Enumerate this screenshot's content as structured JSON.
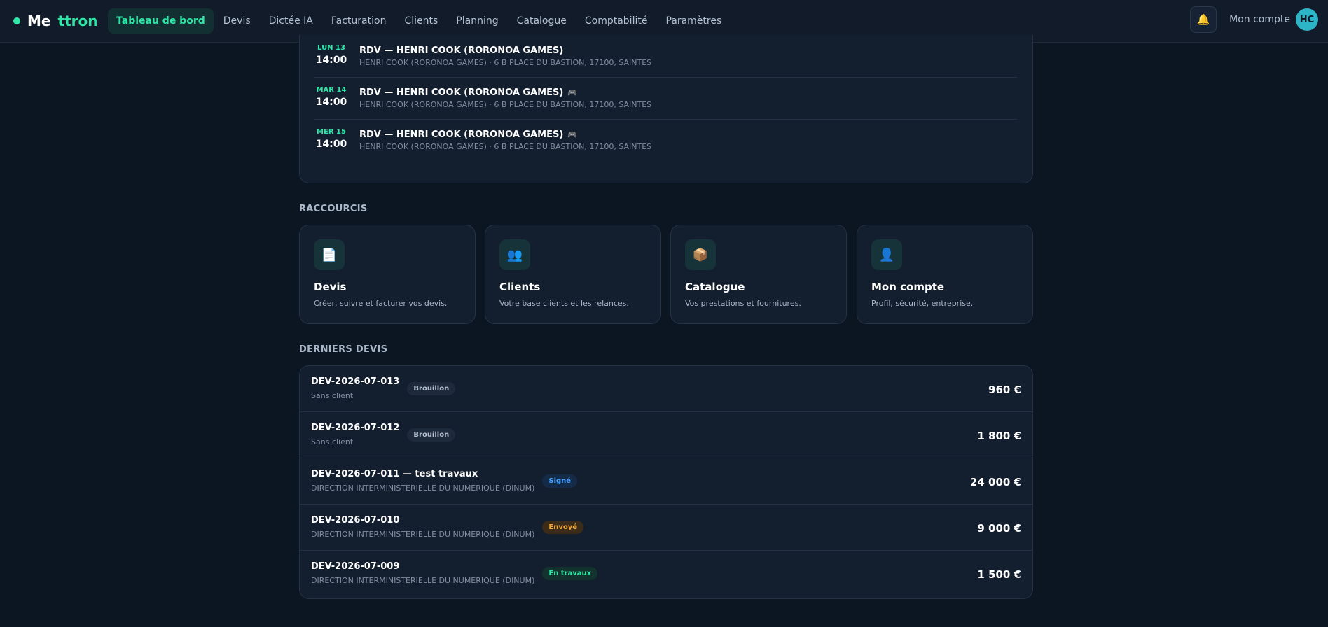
{
  "brand": {
    "part1": "Me",
    "part2": "ttron"
  },
  "nav": {
    "items": [
      {
        "label": "Tableau de bord",
        "active": true
      },
      {
        "label": "Devis"
      },
      {
        "label": "Dictée IA"
      },
      {
        "label": "Facturation"
      },
      {
        "label": "Clients"
      },
      {
        "label": "Planning"
      },
      {
        "label": "Catalogue"
      },
      {
        "label": "Comptabilité"
      },
      {
        "label": "Paramètres"
      }
    ]
  },
  "account": {
    "label": "Mon compte",
    "initials": "HC"
  },
  "agenda": {
    "events": [
      {
        "day": "LUN 13",
        "time": "14:00",
        "title": "RDV — HENRI COOK (RORONOA GAMES)",
        "subtitle": "HENRI COOK (RORONOA GAMES) · 6 B PLACE DU BASTION, 17100, SAINTES",
        "icon": "game-controller-icon"
      },
      {
        "day": "MAR 14",
        "time": "14:00",
        "title": "RDV — HENRI COOK (RORONOA GAMES)",
        "subtitle": "HENRI COOK (RORONOA GAMES) · 6 B PLACE DU BASTION, 17100, SAINTES",
        "icon": "game-controller-icon"
      },
      {
        "day": "MER 15",
        "time": "14:00",
        "title": "RDV — HENRI COOK (RORONOA GAMES)",
        "subtitle": "HENRI COOK (RORONOA GAMES) · 6 B PLACE DU BASTION, 17100, SAINTES",
        "icon": "game-controller-icon"
      }
    ]
  },
  "shortcuts": {
    "title": "RACCOURCIS",
    "items": [
      {
        "title": "Devis",
        "desc": "Créer, suivre et facturer vos devis.",
        "icon": "document-icon"
      },
      {
        "title": "Clients",
        "desc": "Votre base clients et les relances.",
        "icon": "users-icon"
      },
      {
        "title": "Catalogue",
        "desc": "Vos prestations et fournitures.",
        "icon": "package-icon"
      },
      {
        "title": "Mon compte",
        "desc": "Profil, sécurité, entreprise.",
        "icon": "user-icon"
      }
    ]
  },
  "quotes": {
    "title": "DERNIERS DEVIS",
    "rows": [
      {
        "title": "DEV-2026-07-013",
        "client": "Sans client",
        "status": "Brouillon",
        "amount": "960 €"
      },
      {
        "title": "DEV-2026-07-012",
        "client": "Sans client",
        "status": "Brouillon",
        "amount": "1 800 €"
      },
      {
        "title": "DEV-2026-07-011 — test travaux",
        "client": "DIRECTION INTERMINISTERIELLE DU NUMERIQUE (DINUM)",
        "status": "Signé",
        "amount": "24 000 €"
      },
      {
        "title": "DEV-2026-07-010",
        "client": "DIRECTION INTERMINISTERIELLE DU NUMERIQUE (DINUM)",
        "status": "Envoyé",
        "amount": "9 000 €"
      },
      {
        "title": "DEV-2026-07-009",
        "client": "DIRECTION INTERMINISTERIELLE DU NUMERIQUE (DINUM)",
        "status": "En travaux",
        "amount": "1 500 €"
      }
    ]
  },
  "colors": {
    "accent": "#2ee6a6",
    "background": "#0c1522",
    "card": "#131f2f",
    "status_draft": "#b4c1d2",
    "status_signed": "#4aa3ff",
    "status_sent": "#f2a93a",
    "status_work": "#2ee6a6"
  }
}
